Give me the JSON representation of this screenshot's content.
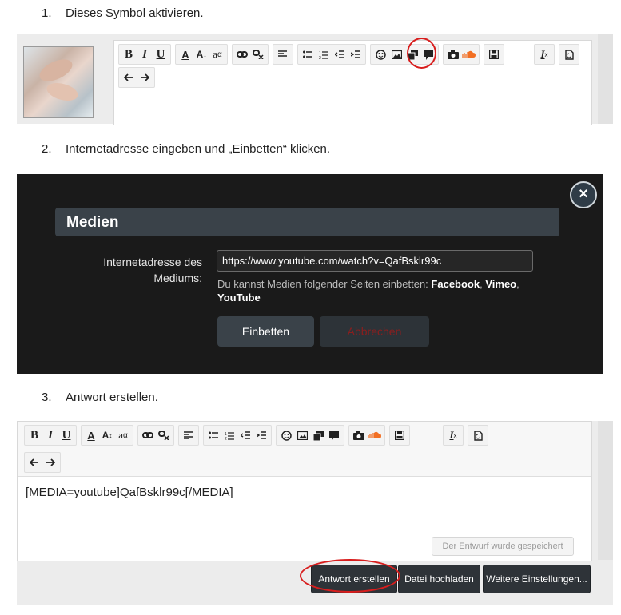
{
  "steps": [
    {
      "num": "1.",
      "text": "Dieses Symbol aktivieren."
    },
    {
      "num": "2.",
      "text": "Internetadresse eingeben und „Einbetten“ klicken."
    },
    {
      "num": "3.",
      "text": "Antwort erstellen."
    }
  ],
  "toolbar": {
    "bold": "B",
    "italic": "I",
    "underline": "U",
    "text_color": "A",
    "font_size": "A",
    "font_family": "a",
    "remove_format": "I"
  },
  "modal": {
    "title": "Medien",
    "label_line1": "Internetadresse des",
    "label_line2": "Mediums:",
    "url_value": "https://www.youtube.com/watch?v=QafBsklr99c",
    "hint_prefix": "Du kannst Medien folgender Seiten einbetten:",
    "sites": [
      "Facebook",
      "Vimeo",
      "YouTube"
    ],
    "embed_button": "Einbetten",
    "cancel_button": "Abbrechen"
  },
  "editor": {
    "content": "[MEDIA=youtube]QafBsklr99c[/MEDIA]",
    "draft_status": "Der Entwurf wurde gespeichert"
  },
  "actions": {
    "create_reply": "Antwort erstellen",
    "upload_file": "Datei hochladen",
    "more_options": "Weitere Einstellungen..."
  },
  "colors": {
    "highlight_circle": "#d81d1d",
    "modal_background": "#1a1a1a",
    "modal_header": "#3a4249",
    "action_button": "#2e3338"
  }
}
